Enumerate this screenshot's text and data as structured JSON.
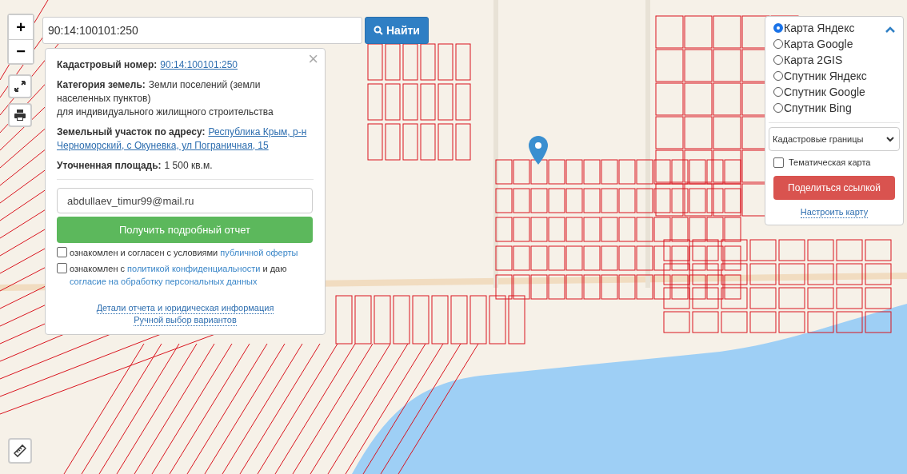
{
  "map_controls": {
    "zoom_in": "+",
    "zoom_out": "−"
  },
  "search": {
    "value": "90:14:100101:250",
    "button": "Найти"
  },
  "popup": {
    "close": "×",
    "fields": [
      {
        "label": "Кадастровый номер:",
        "kind": "link",
        "lines": [
          "90:14:100101:250"
        ]
      },
      {
        "label": "Категория земель:",
        "kind": "text",
        "lines": [
          "Земли поселений (земли",
          "населенных пунктов)",
          "для индивидуального жилищного строительства"
        ]
      },
      {
        "label": "Земельный участок по адресу:",
        "kind": "link",
        "lines": [
          "Республика Крым, р-н",
          "Черноморский, с Окуневка, ул Пограничная, 15"
        ]
      },
      {
        "label": "Уточненная площадь:",
        "kind": "text",
        "lines": [
          "1 500 кв.м."
        ]
      }
    ],
    "email": "abdullaev_timur99@mail.ru",
    "report_button": "Получить подробный отчет",
    "consents": [
      {
        "checked": false,
        "parts": [
          {
            "text": "ознакомлен и согласен с условиями",
            "link": false
          },
          {
            "text": "публичной оферты",
            "link": true
          }
        ]
      },
      {
        "checked": false,
        "parts": [
          {
            "text": "ознакомлен с",
            "link": false
          },
          {
            "text": "политикой конфиденциальности",
            "link": true
          },
          {
            "text": "и даю",
            "link": false
          },
          {
            "text": "согласие на обработку персональных данных",
            "link": true
          }
        ]
      }
    ],
    "footer_links": [
      "Детали отчета и юридическая информация",
      "Ручной выбор вариантов"
    ]
  },
  "layers": {
    "options": [
      {
        "label": "Карта Яндекс",
        "selected": true
      },
      {
        "label": "Карта Google",
        "selected": false
      },
      {
        "label": "Карта 2GIS",
        "selected": false
      },
      {
        "label": "Спутник Яндекс",
        "selected": false
      },
      {
        "label": "Спутник Google",
        "selected": false
      },
      {
        "label": "Спутник Bing",
        "selected": false
      }
    ],
    "overlay_select": "Кадастровые границы",
    "thematic": {
      "label": "Тематическая карта",
      "checked": false
    },
    "share_button": "Поделиться ссылкой",
    "settings_link": "Настроить карту"
  }
}
